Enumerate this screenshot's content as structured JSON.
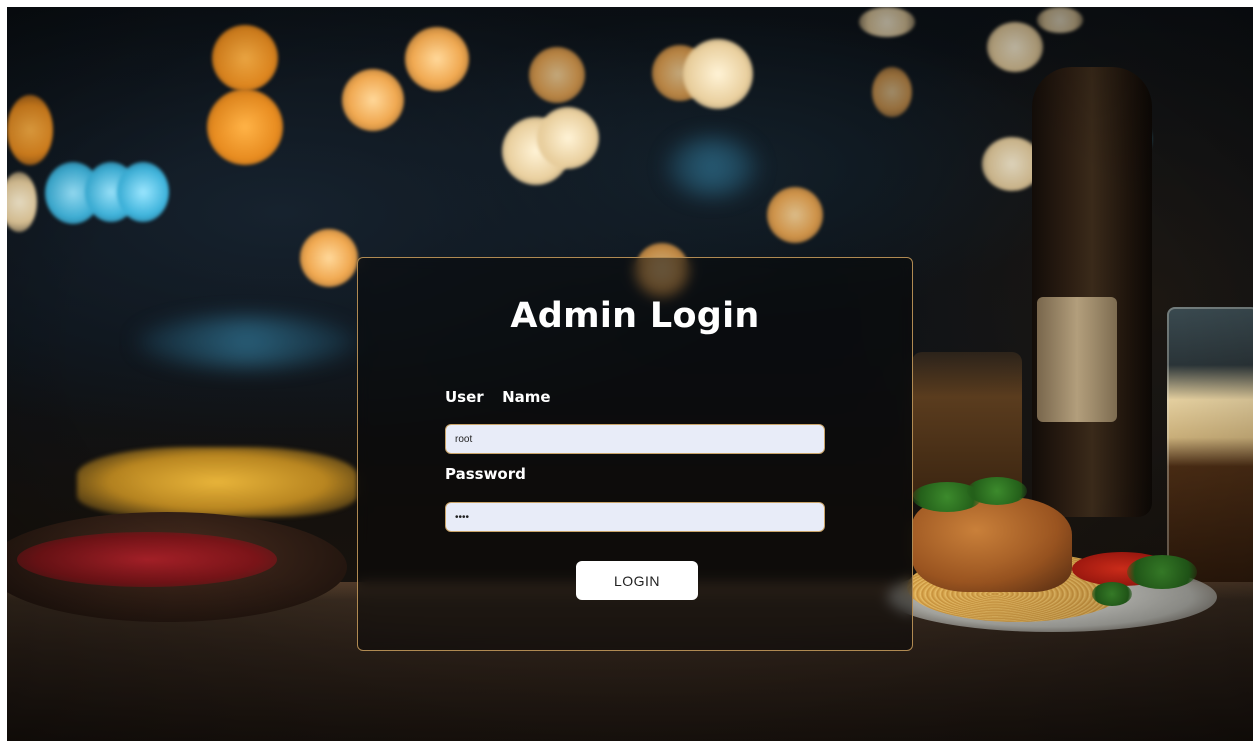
{
  "login_form": {
    "title": "Admin Login",
    "username_label": "User  Name",
    "username_value": "root",
    "password_label": "Password",
    "password_value": "root",
    "submit_label": "LOGIN"
  },
  "colors": {
    "card_border": "#b08a52",
    "input_background": "#e8ecf8",
    "input_border": "#c9a469",
    "button_background": "#ffffff",
    "title_color": "#ffffff"
  }
}
